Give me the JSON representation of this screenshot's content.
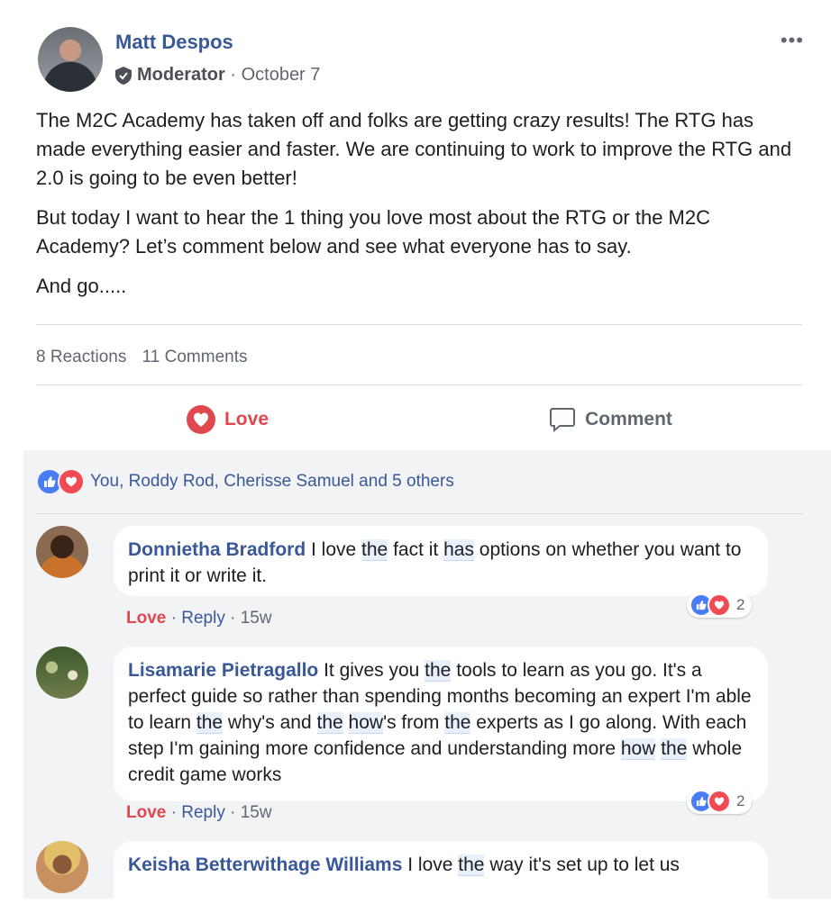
{
  "post": {
    "author": "Matt Despos",
    "role": "Moderator",
    "date": "October 7",
    "more": "•••",
    "paragraphs": [
      "The M2C Academy has taken off and folks are getting crazy results! The RTG has made everything easier and faster. We are continuing to work to improve the RTG and 2.0 is going to be even better!",
      "But today I want to hear the 1 thing you love most about the RTG or the M2C Academy? Let’s comment below and see what everyone has to say.",
      "And go....."
    ],
    "reactions_count": "8 Reactions",
    "comments_count": "11 Comments",
    "love_label": "Love",
    "comment_label": "Comment"
  },
  "reactors": "You, Roddy Rod, Cherisse Samuel and 5 others",
  "comments": [
    {
      "name": "Donnietha Bradford",
      "text_parts": [
        " I love ",
        "the",
        " fact it ",
        "has",
        " options on whether you want to print it or write it."
      ],
      "love": "Love",
      "reply": "Reply",
      "time": "15w",
      "reaction_count": "2"
    },
    {
      "name": "Lisamarie Pietragallo",
      "text_parts": [
        " It gives you ",
        "the",
        " tools to learn as you go. It's a perfect guide so rather than spending months becoming an expert I'm able to learn ",
        "the",
        " why's and ",
        "the",
        " ",
        "how",
        "'s from ",
        "the",
        " experts as I go along. With each step I'm gaining more confidence and understanding more ",
        "how",
        " ",
        "the",
        " whole credit game works"
      ],
      "love": "Love",
      "reply": "Reply",
      "time": "15w",
      "reaction_count": "2"
    },
    {
      "name": "Keisha Betterwithage Williams",
      "text_parts": [
        " I love ",
        "the",
        " way it's set up to let us"
      ]
    }
  ],
  "colors": {
    "link": "#385898",
    "love": "#e0484f",
    "like": "#4a7cf7",
    "panel": "#f2f3f5"
  }
}
